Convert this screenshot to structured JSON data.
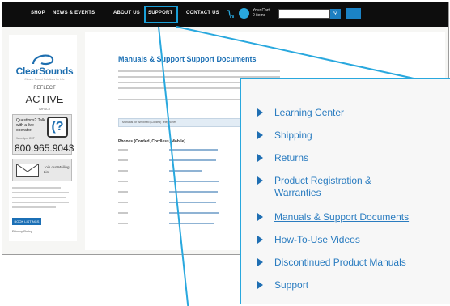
{
  "topnav": {
    "items": [
      "SHOP",
      "NEWS & EVENTS",
      "ABOUT US",
      "SUPPORT",
      "CONTACT US"
    ],
    "cart_label": "Your Cart",
    "cart_sub": "0 items"
  },
  "sidebar": {
    "logo": "ClearSounds",
    "tagline": "Clearer Sound Solutions for Life",
    "reflect": "REFLECT",
    "active": "ACTIVE",
    "impact": "IMPACT",
    "questions_title": "Questions? Talk with a live operator.",
    "questions_mark": "(?",
    "hours": "9am-5pm CST",
    "phone": "800.965.9043",
    "mail_label": "Join our Mailing List",
    "button": "BOOK LISTINGS",
    "privacy": "Privacy Policy"
  },
  "content": {
    "title": "Manuals & Support Support Documents",
    "filter_label": "Manuals for Amplified (Corded) Telephones",
    "table_header": "Phones (Corded, Cordless, Mobile)"
  },
  "zoom_menu": {
    "items": [
      {
        "label": "Learning Center"
      },
      {
        "label": "Shipping"
      },
      {
        "label": "Returns"
      },
      {
        "label": "Product Registration & Warranties"
      },
      {
        "label": "Manuals & Support Documents"
      },
      {
        "label": "How-To-Use Videos"
      },
      {
        "label": "Discontinued Product Manuals"
      },
      {
        "label": "Support"
      }
    ]
  },
  "colors": {
    "accent": "#29a8de",
    "brand": "#1e6fb0",
    "nav_bg": "#0d0d0d"
  }
}
